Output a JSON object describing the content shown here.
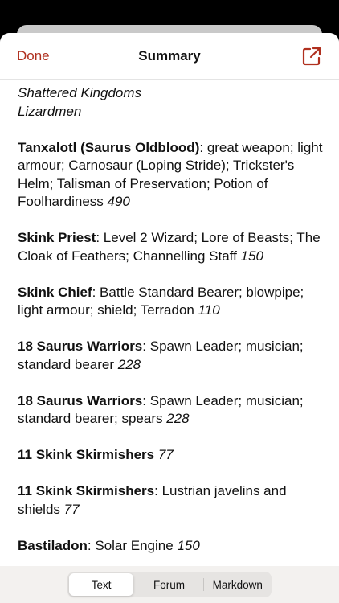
{
  "nav": {
    "done_label": "Done",
    "title": "Summary",
    "share_icon": "share-icon"
  },
  "army": {
    "game": "Shattered Kingdoms",
    "faction": "Lizardmen",
    "units": [
      {
        "name": "Tanxalotl (Saurus Oldblood)",
        "details": "great weapon; light armour; Carnosaur (Loping Stride); Trickster's Helm; Talisman of Preservation; Potion of Foolhardiness",
        "points": "490"
      },
      {
        "name": "Skink Priest",
        "details": "Level 2 Wizard; Lore of Beasts; The Cloak of Feathers; Channelling Staff",
        "points": "150"
      },
      {
        "name": "Skink Chief",
        "details": "Battle Standard Bearer; blowpipe; light armour; shield; Terradon",
        "points": "110"
      },
      {
        "name": "18 Saurus Warriors",
        "details": "Spawn Leader; musician; standard bearer",
        "points": "228"
      },
      {
        "name": "18 Saurus Warriors",
        "details": "Spawn Leader; musician; standard bearer; spears",
        "points": "228"
      },
      {
        "name": "11 Skink Skirmishers",
        "details": "",
        "points": "77"
      },
      {
        "name": "11 Skink Skirmishers",
        "details": "Lustrian javelins and shields",
        "points": "77"
      },
      {
        "name": "Bastiladon",
        "details": "Solar Engine",
        "points": "150"
      }
    ]
  },
  "footer": {
    "tabs": [
      "Text",
      "Forum",
      "Markdown"
    ],
    "selected": "Text"
  },
  "colors": {
    "accent": "#b0301f"
  }
}
